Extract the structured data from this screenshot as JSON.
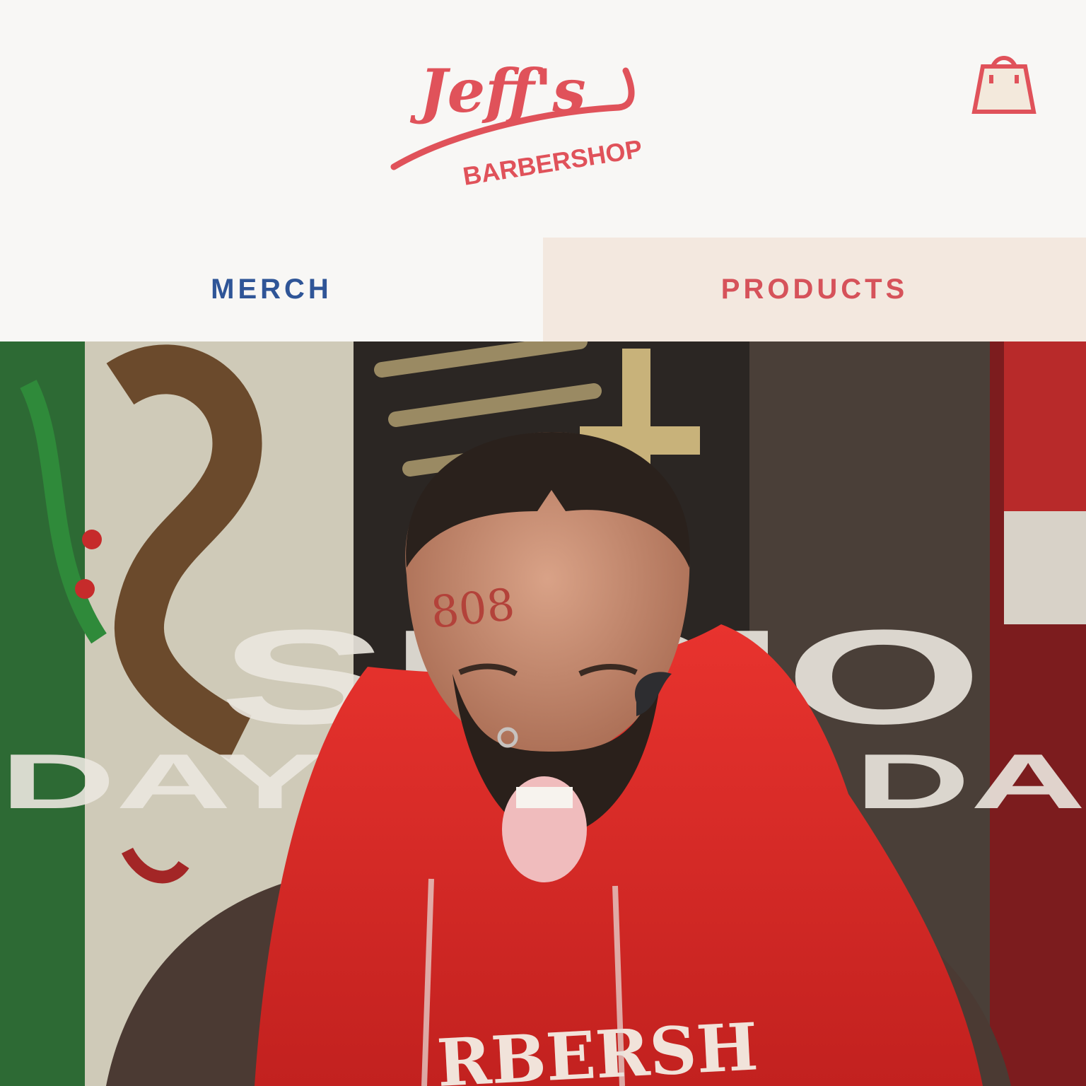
{
  "header": {
    "logo": {
      "script_text": "Jeff's",
      "sub_text": "BARBERSHOP"
    },
    "cart_icon": "shopping-bag-icon"
  },
  "tabs": [
    {
      "label": "MERCH"
    },
    {
      "label": "PRODUCTS"
    }
  ],
  "hero": {
    "poster_text_line1": "SI RIO",
    "poster_text_line2": "DAY OF OLDA",
    "tattoo_text": "808",
    "hoodie_text": "RBERSH"
  },
  "colors": {
    "brand_red": "#e0525a",
    "merch_blue": "#2f5597",
    "products_bg": "#f3e8df",
    "page_bg": "#f8f7f5"
  }
}
